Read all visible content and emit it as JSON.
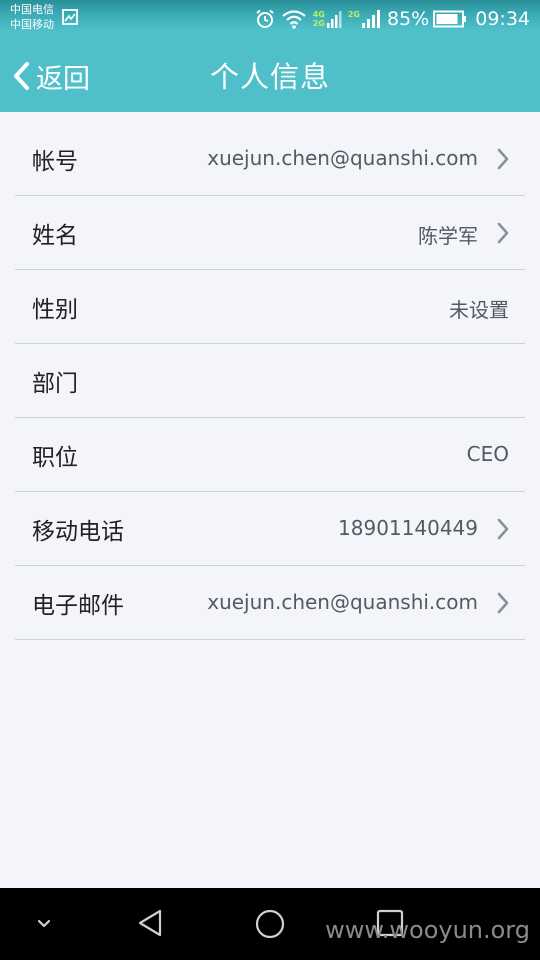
{
  "status_bar": {
    "carrier_1": "中国电信",
    "carrier_2": "中国移动",
    "net_label_1_top": "4G",
    "net_label_1_bottom": "2G",
    "net_label_2_top": "2G",
    "battery_percent": "85%",
    "time": "09:34",
    "icons": [
      "gallery-icon",
      "alarm-icon",
      "wifi-icon",
      "signal-icon",
      "battery-icon"
    ]
  },
  "header": {
    "back_label": "返回",
    "title": "个人信息",
    "background_color": "#4fc0ca"
  },
  "profile_rows": [
    {
      "label": "帐号",
      "value": "xuejun.chen@quanshi.com",
      "has_arrow": true
    },
    {
      "label": "姓名",
      "value": "陈学军",
      "has_arrow": true
    },
    {
      "label": "性别",
      "value": "未设置",
      "has_arrow": false
    },
    {
      "label": "部门",
      "value": "",
      "has_arrow": false
    },
    {
      "label": "职位",
      "value": "CEO",
      "has_arrow": false
    },
    {
      "label": "移动电话",
      "value": "18901140449",
      "has_arrow": true
    },
    {
      "label": "电子邮件",
      "value": "xuejun.chen@quanshi.com",
      "has_arrow": true
    }
  ],
  "system_nav": {
    "buttons": [
      "collapse-icon",
      "back-triangle-icon",
      "home-circle-icon",
      "recents-square-icon"
    ],
    "watermark": "www.wooyun.org"
  }
}
